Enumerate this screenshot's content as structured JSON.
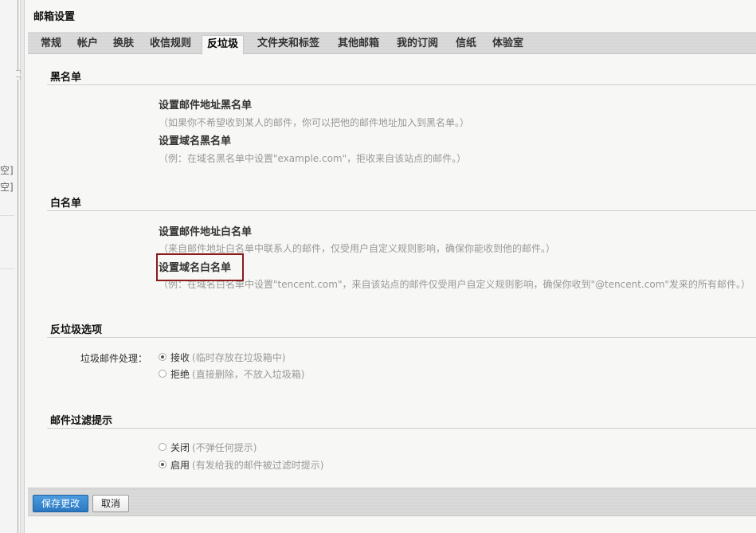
{
  "side": {
    "text_1": "空]",
    "text_2": "空]"
  },
  "panel": {
    "title": "邮箱设置"
  },
  "tabs": [
    {
      "label": "常规"
    },
    {
      "label": "帐户"
    },
    {
      "label": "换肤"
    },
    {
      "label": "收信规则"
    },
    {
      "label": "反垃圾"
    },
    {
      "label": "文件夹和标签"
    },
    {
      "label": "其他邮箱"
    },
    {
      "label": "我的订阅"
    },
    {
      "label": "信纸"
    },
    {
      "label": "体验室"
    }
  ],
  "blacklist": {
    "heading": "黑名单",
    "address_title": "设置邮件地址黑名单",
    "address_desc": "（如果你不希望收到某人的邮件，你可以把他的邮件地址加入到黑名单。）",
    "domain_title": "设置域名黑名单",
    "domain_desc": "（例：在域名黑名单中设置\"example.com\"，拒收来自该站点的邮件。）"
  },
  "whitelist": {
    "heading": "白名单",
    "address_title": "设置邮件地址白名单",
    "address_desc": "（来自邮件地址白名单中联系人的邮件，仅受用户自定义规则影响，确保你能收到他的邮件。）",
    "domain_title": "设置域名白名单",
    "domain_desc": "（例：在域名白名单中设置\"tencent.com\"，来自该站点的邮件仅受用户自定义规则影响，确保你收到\"@tencent.com\"发来的所有邮件。）"
  },
  "antispam": {
    "heading": "反垃圾选项",
    "label": "垃圾邮件处理：",
    "options": [
      {
        "label": "接收",
        "note": "(临时存放在垃圾箱中)",
        "checked": true
      },
      {
        "label": "拒绝",
        "note": "(直接删除，不放入垃圾箱)",
        "checked": false
      }
    ]
  },
  "filter": {
    "heading": "邮件过滤提示",
    "options": [
      {
        "label": "关闭",
        "note": "(不弹任何提示)",
        "checked": false
      },
      {
        "label": "启用",
        "note": "(有发给我的邮件被过滤时提示)",
        "checked": true
      }
    ]
  },
  "buttons": {
    "save": "保存更改",
    "cancel": "取消"
  },
  "colors": {
    "primary_button": "#2a78c2",
    "highlight_box": "#8b1a1a"
  }
}
